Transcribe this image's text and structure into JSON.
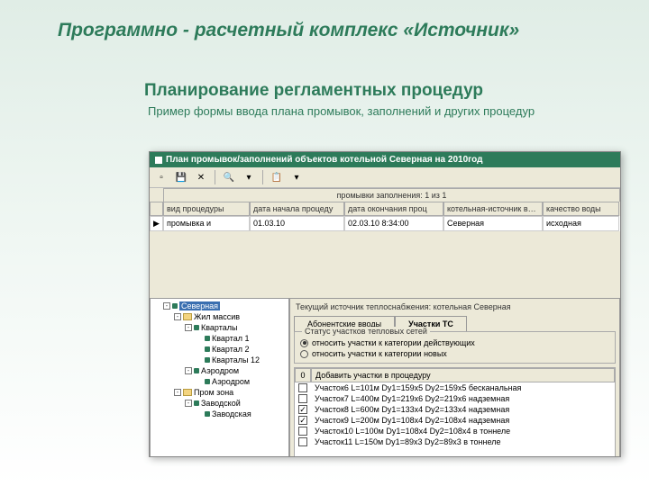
{
  "page": {
    "title": "Программно - расчетный комплекс «Источник»",
    "section": "Планирование регламентных процедур",
    "sub": "Пример формы ввода плана промывок, заполнений и других процедур"
  },
  "window": {
    "title": "План промывок/заполнений объектов котельной Северная на 2010год"
  },
  "grid": {
    "caption": "промывки заполнения: 1 из 1",
    "cols": {
      "vid": "вид процедуры",
      "d1": "дата начала процеду",
      "d2": "дата окончания проц",
      "kot": "котельная-источник в…",
      "kv": "качество воды"
    },
    "row": {
      "vid": "промывка и",
      "d1": "01.03.10",
      "d2": "02.03.10 8:34:00",
      "kot": "Северная",
      "kv": "исходная"
    }
  },
  "tree": {
    "root": "Северная",
    "n1": "Жил массив",
    "n1a": "Кварталы",
    "n1a1": "Квартал 1",
    "n1a2": "Квартал 2",
    "n1a3": "Кварталы 12",
    "n1b": "Аэродром",
    "n1b1": "Аэродром",
    "n2": "Пром зона",
    "n2a": "Заводской",
    "n2a1": "Заводская"
  },
  "right": {
    "src": "Текущий источник теплоснабжения: котельная Северная",
    "tab1": "Абонентские вводы",
    "tab2": "Участки ТС",
    "group": "Статус участков тепловых сетей",
    "opt1": "относить участки к категории действующих",
    "opt2": "относить участки к категории новых",
    "col0": "0",
    "col1": "Добавить участки в процедуру",
    "rows": [
      {
        "chk": false,
        "t": "Участок6  L=101м  Dу1=159x5  Dу2=159x5  бесканальная"
      },
      {
        "chk": false,
        "t": "Участок7  L=400м  Dу1=219x6  Dу2=219x6  надземная"
      },
      {
        "chk": true,
        "t": "Участок8  L=600м  Dу1=133x4  Dу2=133x4  надземная"
      },
      {
        "chk": true,
        "t": "Участок9  L=200м  Dу1=108x4  Dу2=108x4  надземная"
      },
      {
        "chk": false,
        "t": "Участок10  L=100м  Dу1=108x4  Dу2=108x4  в тоннеле"
      },
      {
        "chk": false,
        "t": "Участок11  L=150м  Dу1=89x3  Dу2=89x3  в тоннеле"
      }
    ]
  }
}
